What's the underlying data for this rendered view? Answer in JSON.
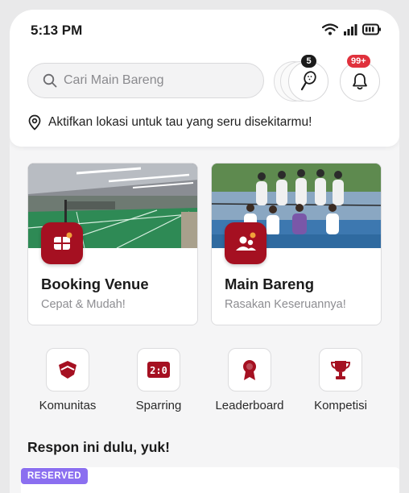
{
  "status_bar": {
    "time": "5:13 PM"
  },
  "search": {
    "placeholder": "Cari Main Bareng"
  },
  "header_actions": {
    "racket_count": "5",
    "notification_count": "99+"
  },
  "location": {
    "text": "Aktifkan lokasi untuk tau yang seru disekitarmu!"
  },
  "cards": [
    {
      "title": "Booking Venue",
      "subtitle": "Cepat & Mudah!",
      "icon": "venue-icon"
    },
    {
      "title": "Main Bareng",
      "subtitle": "Rasakan Keseruannya!",
      "icon": "group-icon"
    }
  ],
  "menu": [
    {
      "label": "Komunitas",
      "icon": "shield-icon"
    },
    {
      "label": "Sparring",
      "icon": "scoreboard-icon"
    },
    {
      "label": "Leaderboard",
      "icon": "medal-icon"
    },
    {
      "label": "Kompetisi",
      "icon": "trophy-icon"
    }
  ],
  "section": {
    "title": "Respon ini dulu, yuk!",
    "tag": "RESERVED"
  },
  "colors": {
    "brand": "#a51021",
    "badge_dark": "#1b1b1b",
    "badge_red": "#e0313c",
    "tag": "#8b6ff0"
  }
}
